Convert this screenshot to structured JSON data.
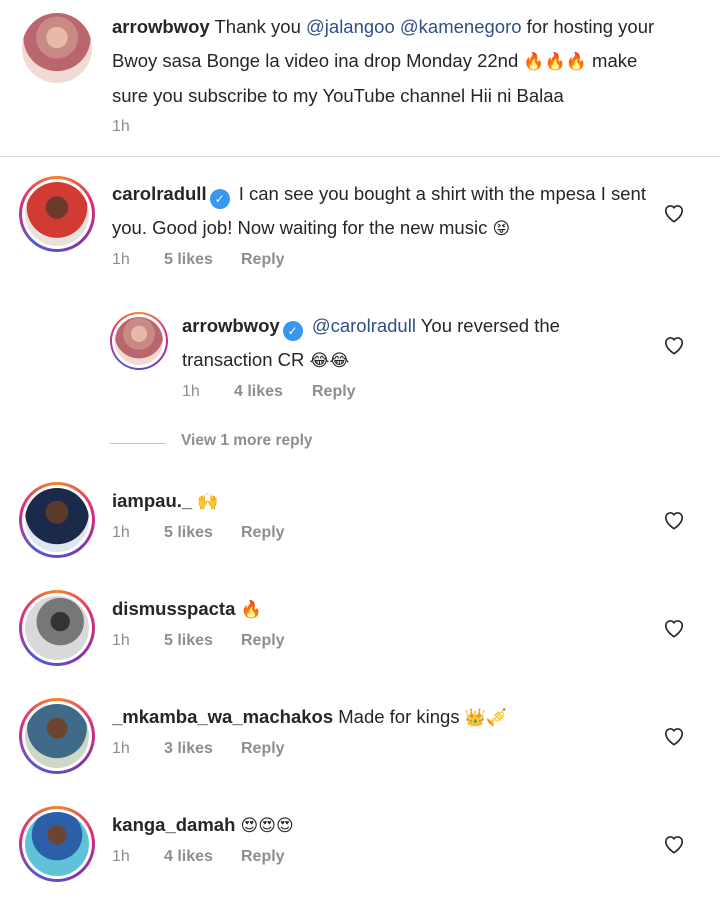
{
  "post_caption": {
    "username": "arrowbwoy",
    "segments": {
      "a": "Thank you ",
      "mention1": "@jalangoo",
      "mention2": "@kamenegoro",
      "b": " for hosting your",
      "c": "Bwoy  sasa Bonge la video ina drop Monday 22nd",
      "emoji": "🔥🔥🔥",
      "d": "make",
      "e": "sure you subscribe to my YouTube channel Hii ni Balaa"
    },
    "time": "1h"
  },
  "comments": [
    {
      "username": "carolradull",
      "verified": true,
      "line1": "I can see you bought a shirt with the mpesa I sent",
      "line2": "you. Good job! Now waiting for the new music",
      "emoji": "😝",
      "time": "1h",
      "likes": "5 likes",
      "reply": "Reply"
    },
    {
      "username": "arrowbwoy",
      "verified": true,
      "mention": "@carolradull",
      "line1": "You reversed the",
      "line2": "transaction CR",
      "emoji": "😂😂",
      "time": "1h",
      "likes": "4 likes",
      "reply": "Reply"
    },
    {
      "username": "iampau._",
      "emoji": "🙌",
      "time": "1h",
      "likes": "5 likes",
      "reply": "Reply"
    },
    {
      "username": "dismusspacta",
      "emoji": "🔥",
      "time": "1h",
      "likes": "5 likes",
      "reply": "Reply"
    },
    {
      "username": "_mkamba_wa_machakos",
      "text": "Made for kings",
      "emoji": "👑🎺",
      "time": "1h",
      "likes": "3 likes",
      "reply": "Reply"
    },
    {
      "username": "kanga_damah",
      "emoji": "😍😍😍",
      "time": "1h",
      "likes": "4 likes",
      "reply": "Reply"
    }
  ],
  "view_more_replies": "View 1 more reply",
  "icons": {
    "verified": "verified-badge-icon",
    "like": "heart-outline-icon"
  },
  "colors": {
    "mention": "#2f4f8b",
    "verified": "#3897f0",
    "meta": "#8e8e8e"
  }
}
